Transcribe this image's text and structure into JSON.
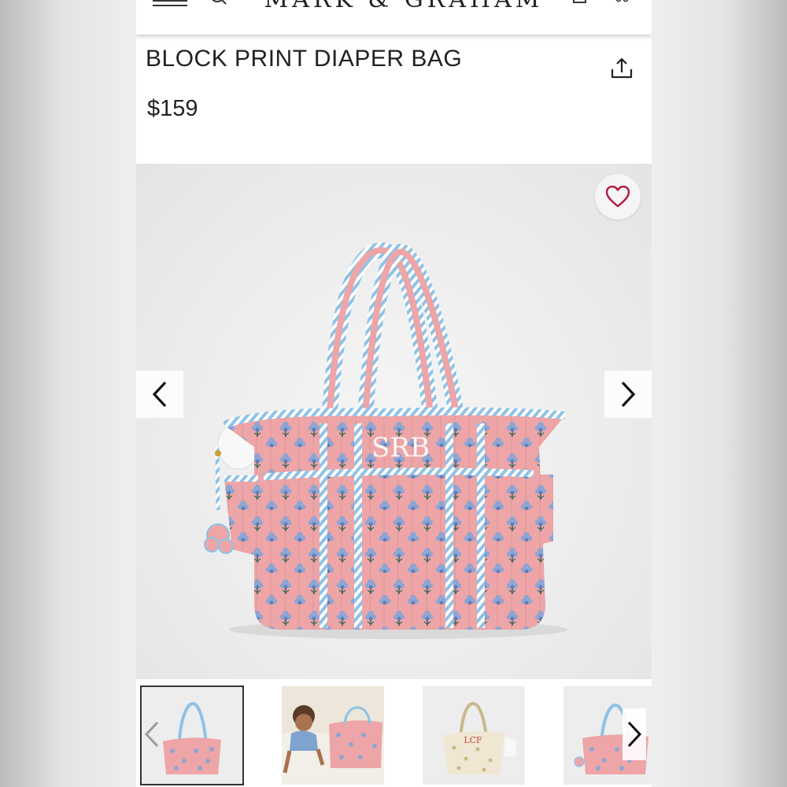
{
  "header": {
    "brand": "MARK & GRAHAM",
    "icons": [
      "menu-icon",
      "search-icon",
      "shopping-bag-icon",
      "more-icon"
    ]
  },
  "product": {
    "title": "BLOCK PRINT DIAPER BAG",
    "price": "$159",
    "monogram": "SRB"
  },
  "gallery": {
    "thumbnail_count": 4,
    "active_thumbnail": 1,
    "monogram_thumb": "LCF"
  },
  "colors": {
    "bag_pink": "#eda5a7",
    "print_blue": "#8fa5d3",
    "trim_blue": "#8ec2e6",
    "heart": "#b1173b",
    "text": "#222222"
  }
}
